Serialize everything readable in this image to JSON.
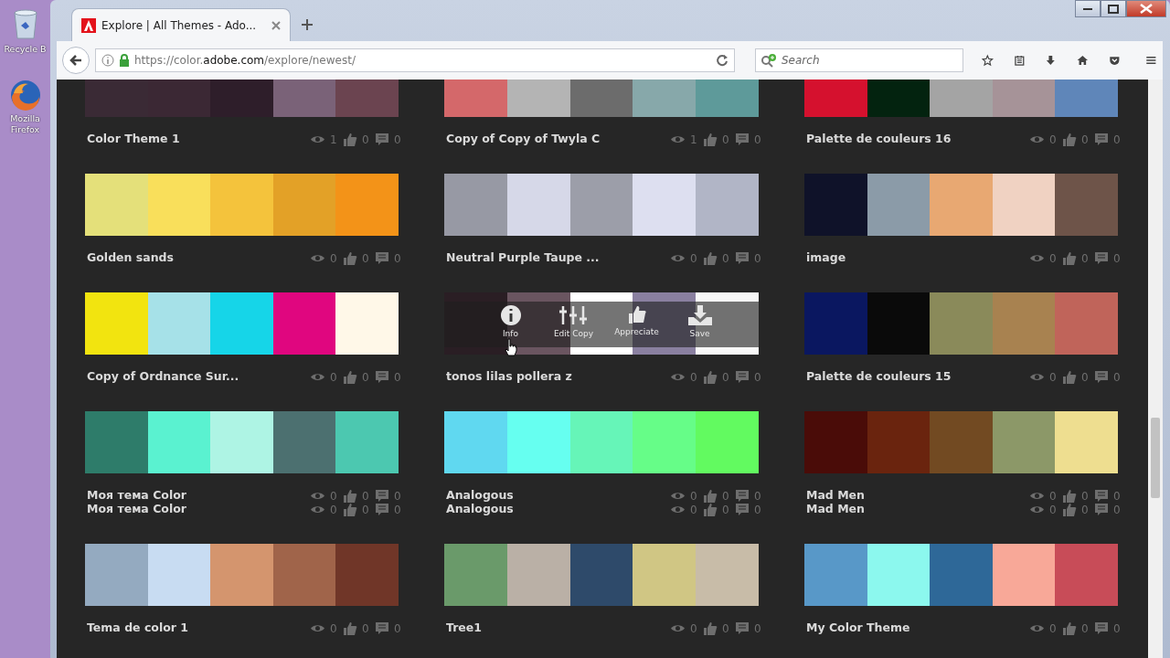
{
  "desktop": {
    "icons": [
      {
        "label": "Recycle B",
        "kind": "bin"
      },
      {
        "label": "Mozilla Firefox",
        "kind": "firefox"
      }
    ]
  },
  "browser": {
    "tab": {
      "title": "Explore | All Themes - Ado...",
      "selected": true
    },
    "url": {
      "host_prefix": "https://color.",
      "domain": "adobe.com",
      "path": "/explore/newest/"
    },
    "search": {
      "placeholder": "Search"
    }
  },
  "themes": [
    {
      "colors": [
        {
          "color": "#3a2a35"
        },
        {
          "color": "#3b2834"
        },
        {
          "color": "#2e1e2a"
        },
        {
          "color": "#7a6278"
        },
        {
          "color": "#6b4450"
        }
      ],
      "lines": [
        {
          "name": "Color Theme 1",
          "views": "1",
          "likes": "0",
          "comments": "0"
        }
      ]
    },
    {
      "colors": [
        {
          "color": "#d4686a"
        },
        {
          "color": "#b4b4b4"
        },
        {
          "color": "#6c6c6c"
        },
        {
          "color": "#87a8aa"
        },
        {
          "color": "#5e9a9a"
        }
      ],
      "lines": [
        {
          "name": "Copy of Copy of Twyla C",
          "views": "1",
          "likes": "0",
          "comments": "0"
        }
      ]
    },
    {
      "colors": [
        {
          "color": "#d5112e"
        },
        {
          "color": "#03230f"
        },
        {
          "color": "#a4a4a4"
        },
        {
          "color": "#a69398"
        },
        {
          "color": "#5f86b9"
        }
      ],
      "lines": [
        {
          "name": "Palette de couleurs 16",
          "views": "0",
          "likes": "0",
          "comments": "0"
        }
      ]
    },
    {
      "colors": [
        {
          "color": "#e4e07a"
        },
        {
          "color": "#f9df5b"
        },
        {
          "color": "#f4c33c"
        },
        {
          "color": "#e3a127"
        },
        {
          "color": "#f39318"
        }
      ],
      "lines": [
        {
          "name": "Golden sands",
          "views": "0",
          "likes": "0",
          "comments": "0"
        }
      ]
    },
    {
      "colors": [
        {
          "color": "#9799a4"
        },
        {
          "color": "#d6d8e8"
        },
        {
          "color": "#9c9ea9"
        },
        {
          "color": "#dddff0"
        },
        {
          "color": "#b1b5c6"
        }
      ],
      "lines": [
        {
          "name": "Neutral Purple Taupe ...",
          "views": "0",
          "likes": "0",
          "comments": "0"
        }
      ]
    },
    {
      "colors": [
        {
          "color": "#0f1229"
        },
        {
          "color": "#8b9ba8"
        },
        {
          "color": "#e8a872"
        },
        {
          "color": "#f0d2c2"
        },
        {
          "color": "#6e5449"
        }
      ],
      "lines": [
        {
          "name": "image",
          "views": "0",
          "likes": "0",
          "comments": "0"
        }
      ]
    },
    {
      "colors": [
        {
          "color": "#f2e40f"
        },
        {
          "color": "#a6e1e8"
        },
        {
          "color": "#16d5e8"
        },
        {
          "color": "#e0067f"
        },
        {
          "color": "#fff8e8"
        }
      ],
      "lines": [
        {
          "name": "Copy of Ordnance Sur...",
          "views": "0",
          "likes": "0",
          "comments": "0"
        }
      ]
    },
    {
      "colors": [
        {
          "color": "#2a1e24"
        },
        {
          "color": "#6a5560"
        },
        {
          "color": "#ffffff"
        },
        {
          "color": "#8a80a0"
        },
        {
          "color": "#f8f8f8"
        }
      ],
      "lines": [
        {
          "name": "tonos lilas pollera z",
          "views": "0",
          "likes": "0",
          "comments": "0"
        }
      ],
      "hovered": true
    },
    {
      "colors": [
        {
          "color": "#0a1760"
        },
        {
          "color": "#0a0a0a"
        },
        {
          "color": "#8a8a5a"
        },
        {
          "color": "#a88250"
        },
        {
          "color": "#c0645a"
        }
      ],
      "lines": [
        {
          "name": "Palette de couleurs 15",
          "views": "0",
          "likes": "0",
          "comments": "0"
        }
      ]
    },
    {
      "colors": [
        {
          "color": "#2e7c6a"
        },
        {
          "color": "#5af2d0"
        },
        {
          "color": "#aef4e4"
        },
        {
          "color": "#4c7070"
        },
        {
          "color": "#4cc8b0"
        }
      ],
      "lines": [
        {
          "name": "Моя тема Color",
          "views": "0",
          "likes": "0",
          "comments": "0"
        },
        {
          "name": "Моя тема Color",
          "views": "0",
          "likes": "0",
          "comments": "0"
        }
      ]
    },
    {
      "colors": [
        {
          "color": "#60d8f0"
        },
        {
          "color": "#66fff0"
        },
        {
          "color": "#66f5b8"
        },
        {
          "color": "#66fd88"
        },
        {
          "color": "#62fa60"
        }
      ],
      "lines": [
        {
          "name": "Analogous",
          "views": "0",
          "likes": "0",
          "comments": "0"
        },
        {
          "name": "Analogous",
          "views": "0",
          "likes": "0",
          "comments": "0"
        }
      ]
    },
    {
      "colors": [
        {
          "color": "#4a0c08"
        },
        {
          "color": "#6a240e"
        },
        {
          "color": "#724a22"
        },
        {
          "color": "#8c9868"
        },
        {
          "color": "#eede90"
        }
      ],
      "lines": [
        {
          "name": "Mad Men",
          "views": "0",
          "likes": "0",
          "comments": "0"
        },
        {
          "name": "Mad Men",
          "views": "0",
          "likes": "0",
          "comments": "0"
        }
      ]
    },
    {
      "colors": [
        {
          "color": "#94aac0"
        },
        {
          "color": "#c8dcf2"
        },
        {
          "color": "#d4956e"
        },
        {
          "color": "#a0644a"
        },
        {
          "color": "#703628"
        }
      ],
      "lines": [
        {
          "name": "Tema de color 1",
          "views": "0",
          "likes": "0",
          "comments": "0"
        }
      ]
    },
    {
      "colors": [
        {
          "color": "#6a9a6a"
        },
        {
          "color": "#bab0a6"
        },
        {
          "color": "#2e4a6a"
        },
        {
          "color": "#d0c684"
        },
        {
          "color": "#c8bca8"
        }
      ],
      "lines": [
        {
          "name": "Tree1",
          "views": "0",
          "likes": "0",
          "comments": "0"
        }
      ]
    },
    {
      "colors": [
        {
          "color": "#5898c8"
        },
        {
          "color": "#8cf8ee"
        },
        {
          "color": "#2e6898"
        },
        {
          "color": "#f8a898"
        },
        {
          "color": "#c84c58"
        }
      ],
      "lines": [
        {
          "name": "My Color Theme",
          "views": "0",
          "likes": "0",
          "comments": "0"
        }
      ]
    }
  ],
  "hover_actions": [
    {
      "label": "Info",
      "kind": "info"
    },
    {
      "label": "Edit Copy",
      "kind": "edit"
    },
    {
      "label": "Appreciate",
      "kind": "like"
    },
    {
      "label": "Save",
      "kind": "save"
    }
  ]
}
